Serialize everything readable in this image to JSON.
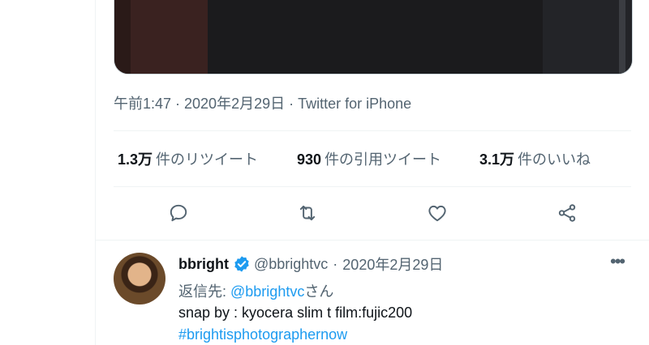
{
  "tweet": {
    "meta": "午前1:47 · 2020年2月29日 · Twitter for iPhone",
    "stats": [
      {
        "value": "1.3万",
        "label": "件のリツイート"
      },
      {
        "value": "930",
        "label": "件の引用ツイート"
      },
      {
        "value": "3.1万",
        "label": "件のいいね"
      }
    ]
  },
  "actions": {
    "reply_icon": "reply-icon",
    "retweet_icon": "retweet-icon",
    "like_icon": "like-icon",
    "share_icon": "share-icon"
  },
  "reply": {
    "name": "bbright",
    "handle": "@bbrightvc",
    "separator": "·",
    "date": "2020年2月29日",
    "more": "•••",
    "reply_prefix": "返信先: ",
    "reply_to": "@bbrightvc",
    "reply_suffix": "さん",
    "text": "snap by : kyocera slim t film:fujic200",
    "hashtag": "#brightisphotographernow"
  },
  "colors": {
    "accent": "#1d9bf0",
    "muted": "#536471",
    "border": "#eff3f4",
    "text": "#0f1419"
  }
}
